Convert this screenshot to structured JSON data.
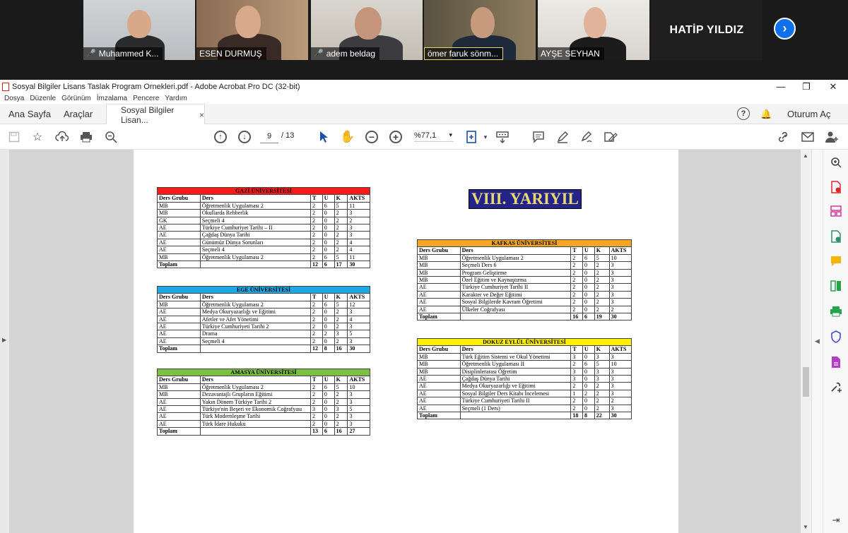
{
  "zoom": {
    "participants": [
      {
        "name": "Muhammed K...",
        "muted": true
      },
      {
        "name": "ESEN DURMUŞ",
        "muted": false
      },
      {
        "name": "adem beldag",
        "muted": true
      },
      {
        "name": "ömer faruk sönm...",
        "muted": false
      },
      {
        "name": "AYŞE SEYHAN",
        "muted": false
      }
    ],
    "name_only_tile": "HATİP YILDIZ",
    "mute_icon": "🎤",
    "next_icon": "›"
  },
  "window": {
    "title": "Sosyal Bilgiler Lisans Taslak Program Ornekleri.pdf - Adobe Acrobat Pro DC (32-bit)",
    "pdf_icon": "PDF",
    "minimize": "—",
    "restore": "❐",
    "close": "✕"
  },
  "menu": [
    "Dosya",
    "Düzenle",
    "Görünüm",
    "İmzalama",
    "Pencere",
    "Yardım"
  ],
  "tabs": {
    "home": "Ana Sayfa",
    "tools": "Araçlar",
    "document": "Sosyal Bilgiler Lisan...",
    "close": "×",
    "sign_in": "Oturum Aç",
    "help": "?",
    "bell": "🔔"
  },
  "toolbar": {
    "page_current": "9",
    "page_total": "/ 13",
    "zoom": "%77,1",
    "dropdown": "▾"
  },
  "pdf": {
    "semester": "VIII. YARIYIL",
    "headers": [
      "Ders Grubu",
      "Ders",
      "T",
      "U",
      "K",
      "AKTS"
    ],
    "total_label": "Toplam",
    "tables": [
      {
        "title": "GAZİ ÜNİVERSİTESİ",
        "color": "#ff1a1a",
        "rows": [
          [
            "MB",
            "Öğretmenlik Uygulaması 2",
            "2",
            "6",
            "5",
            "11"
          ],
          [
            "MB",
            "Okullarda Rehberlik",
            "2",
            "0",
            "2",
            "3"
          ],
          [
            "GK",
            "Seçmeli 4",
            "2",
            "0",
            "2",
            "2"
          ],
          [
            "AE",
            "Türkiye Cumhuriyet Tarihi – II",
            "2",
            "0",
            "2",
            "3"
          ],
          [
            "AE",
            "Çağdaş Dünya Tarihi",
            "2",
            "0",
            "2",
            "3"
          ],
          [
            "AE",
            "Günümüz Dünya Sorunları",
            "2",
            "0",
            "2",
            "4"
          ],
          [
            "AE",
            "Seçmeli 4",
            "2",
            "0",
            "2",
            "4"
          ],
          [
            "MB",
            "Öğretmenlik Uygulaması 2",
            "2",
            "6",
            "5",
            "11"
          ]
        ],
        "total": [
          "12",
          "6",
          "17",
          "30"
        ]
      },
      {
        "title": "EGE ÜNİVERSİTESİ",
        "color": "#1ea8e6",
        "rows": [
          [
            "MB",
            "Öğretmenlik Uygulaması 2",
            "2",
            "6",
            "5",
            "12"
          ],
          [
            "AE",
            "Medya Okuryazarlığı ve Eğitimi",
            "2",
            "0",
            "2",
            "3"
          ],
          [
            "AE",
            "Afetler ve Afet Yönetimi",
            "2",
            "0",
            "2",
            "4"
          ],
          [
            "AE",
            "Türkiye Cumhuriyeti Tarihi 2",
            "2",
            "0",
            "2",
            "3"
          ],
          [
            "AE",
            "Drama",
            "2",
            "2",
            "3",
            "5"
          ],
          [
            "AE",
            "Seçmeli 4",
            "2",
            "0",
            "2",
            "3"
          ]
        ],
        "total": [
          "12",
          "8",
          "16",
          "30"
        ]
      },
      {
        "title": "AMASYA ÜNİVERSİTESİ",
        "color": "#7ac142",
        "rows": [
          [
            "MB",
            "Öğretmenlik Uygulaması 2",
            "2",
            "6",
            "5",
            "10"
          ],
          [
            "MB",
            "Dezavantajlı Grupların Eğitimi",
            "2",
            "0",
            "2",
            "3"
          ],
          [
            "AE",
            "Yakın Dönem Türkiye Tarihi 2",
            "2",
            "0",
            "2",
            "3"
          ],
          [
            "AE",
            "Türkiye'nin Beşeri ve Ekonomik Coğrafyası",
            "3",
            "0",
            "3",
            "5"
          ],
          [
            "AE",
            "Türk Modernleşme Tarihi",
            "2",
            "0",
            "2",
            "3"
          ],
          [
            "AE",
            "Türk İdare Hukuku",
            "2",
            "0",
            "2",
            "3"
          ]
        ],
        "total": [
          "13",
          "6",
          "16",
          "27"
        ]
      },
      {
        "title": "KAFKAS ÜNİVERSİTESİ",
        "color": "#f5a623",
        "rows": [
          [
            "MB",
            "Öğretmenlik Uygulaması 2",
            "2",
            "6",
            "5",
            "10"
          ],
          [
            "MB",
            "Seçmeli Ders 6",
            "2",
            "0",
            "2",
            "3"
          ],
          [
            "MB",
            "Program Geliştirme",
            "2",
            "0",
            "2",
            "3"
          ],
          [
            "MB",
            "Özel Eğitim ve Kaynaştırma",
            "2",
            "0",
            "2",
            "3"
          ],
          [
            "AE",
            "Türkiye Cumhuriyet Tarihi II",
            "2",
            "0",
            "2",
            "3"
          ],
          [
            "AE",
            "Karakter ve Değer Eğitimi",
            "2",
            "0",
            "2",
            "3"
          ],
          [
            "AE",
            "Sosyal Bilgilerde Kavram Öğretimi",
            "2",
            "0",
            "2",
            "3"
          ],
          [
            "AE",
            "Ülkeler Coğrafyası",
            "2",
            "0",
            "2",
            "2"
          ]
        ],
        "total": [
          "16",
          "6",
          "19",
          "30"
        ]
      },
      {
        "title": "DOKUZ EYLÜL ÜNİVERSİTESİ",
        "color": "#ffef00",
        "rows": [
          [
            "MB",
            "Türk Eğitim Sistemi ve Okul Yönetimi",
            "3",
            "0",
            "3",
            "3"
          ],
          [
            "MB",
            "Öğretmenlik Uygulaması II",
            "2",
            "6",
            "5",
            "10"
          ],
          [
            "MB",
            "Disiplinlerarası Öğretim",
            "3",
            "0",
            "3",
            "3"
          ],
          [
            "AE",
            "Çağdaş Dünya Tarihi",
            "3",
            "0",
            "3",
            "3"
          ],
          [
            "AE",
            "Medya Okuryazarlığı ve Eğitimi",
            "2",
            "0",
            "2",
            "3"
          ],
          [
            "AE",
            "Sosyal Bilgiler Ders Kitabı İncelemesi",
            "1",
            "2",
            "2",
            "3"
          ],
          [
            "AE",
            "Türkiye Cumhuriyeti Tarihi II",
            "2",
            "0",
            "2",
            "2"
          ],
          [
            "AE",
            "Seçmeli (1 Ders)",
            "2",
            "0",
            "2",
            "3"
          ]
        ],
        "total": [
          "18",
          "8",
          "22",
          "30"
        ]
      }
    ]
  }
}
